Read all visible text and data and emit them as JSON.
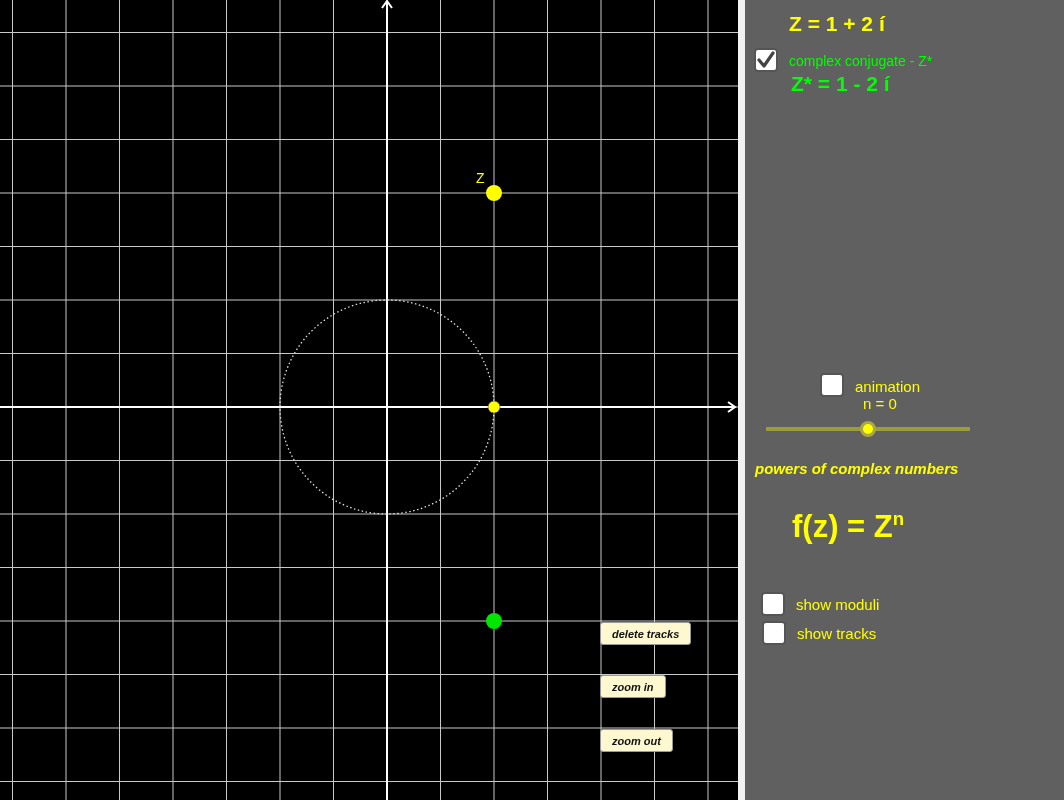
{
  "graph": {
    "point_label": "Z",
    "buttons": [
      "delete tracks",
      "zoom in",
      "zoom out"
    ]
  },
  "panel": {
    "z_value": "Z = 1 + 2 í",
    "conjugate": {
      "label": "complex conjugate - Z*",
      "checked": true
    },
    "conjugate_value": "Z* = 1 - 2 í",
    "animation": {
      "label": "animation",
      "checked": false
    },
    "slider": {
      "reading": "n = 0",
      "level": 0.5
    },
    "subtitle": "powers of complex numbers",
    "formula": "f(z) = Z$^{n}$",
    "options": [
      {
        "label": "show moduli",
        "checked": false
      },
      {
        "label": "show tracks",
        "checked": false
      }
    ]
  }
}
